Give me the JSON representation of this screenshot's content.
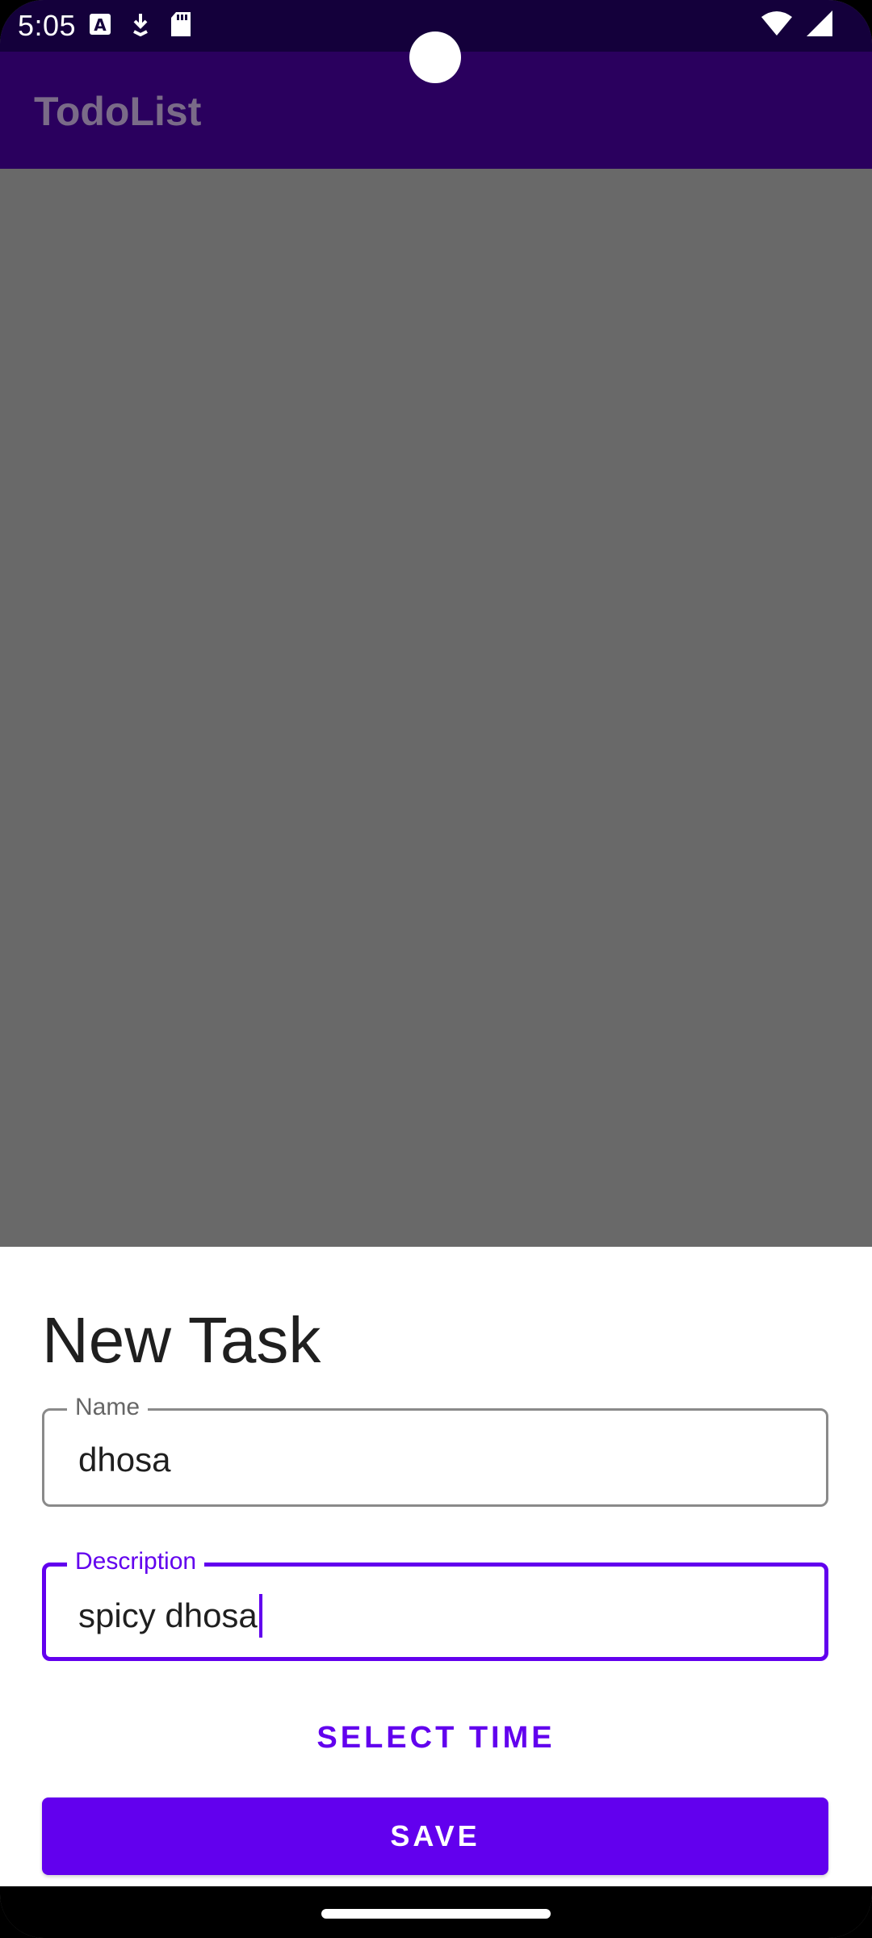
{
  "status_bar": {
    "time": "5:05"
  },
  "app_bar": {
    "title": "TodoList"
  },
  "sheet": {
    "title": "New Task",
    "name_field": {
      "label": "Name",
      "value": "dhosa"
    },
    "description_field": {
      "label": "Description",
      "value": "spicy dhosa"
    },
    "select_time_label": "SELECT TIME",
    "save_label": "SAVE"
  },
  "colors": {
    "primary": "#6200ee",
    "app_bar": "#2a005e",
    "status_bar": "#14003b",
    "scrim": "#696969"
  }
}
